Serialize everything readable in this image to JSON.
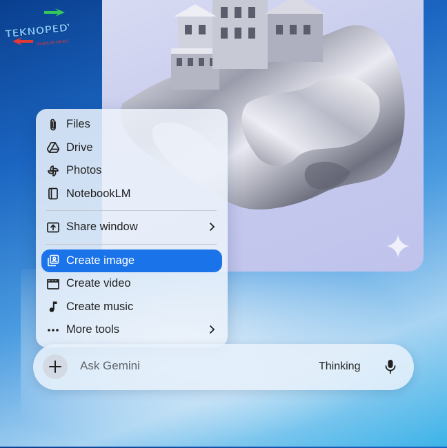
{
  "logo": {
    "name": "TEKNOPEDYA",
    "tagline": "TEKNOLOJİ ANSİKLOPEDİSİ"
  },
  "image_card": {
    "sparkle_icon": "gemini-sparkle-icon"
  },
  "menu": {
    "items": [
      {
        "label": "Files",
        "icon": "paperclip-icon"
      },
      {
        "label": "Drive",
        "icon": "drive-icon"
      },
      {
        "label": "Photos",
        "icon": "photos-pinwheel-icon"
      },
      {
        "label": "NotebookLM",
        "icon": "notebook-icon"
      },
      {
        "label": "Share window",
        "icon": "share-screen-icon",
        "has_submenu": true
      },
      {
        "label": "Create image",
        "icon": "image-gallery-icon",
        "selected": true
      },
      {
        "label": "Create video",
        "icon": "clapperboard-icon"
      },
      {
        "label": "Create music",
        "icon": "music-note-icon"
      },
      {
        "label": "More tools",
        "icon": "more-horiz-icon",
        "has_submenu": true
      }
    ]
  },
  "input_bar": {
    "placeholder": "Ask Gemini",
    "mode_label": "Thinking",
    "plus_icon": "plus-icon",
    "mic_icon": "mic-icon"
  },
  "colors": {
    "selected_bg": "#1a73e8",
    "text": "#1f1f1f",
    "placeholder": "#5f6368"
  }
}
